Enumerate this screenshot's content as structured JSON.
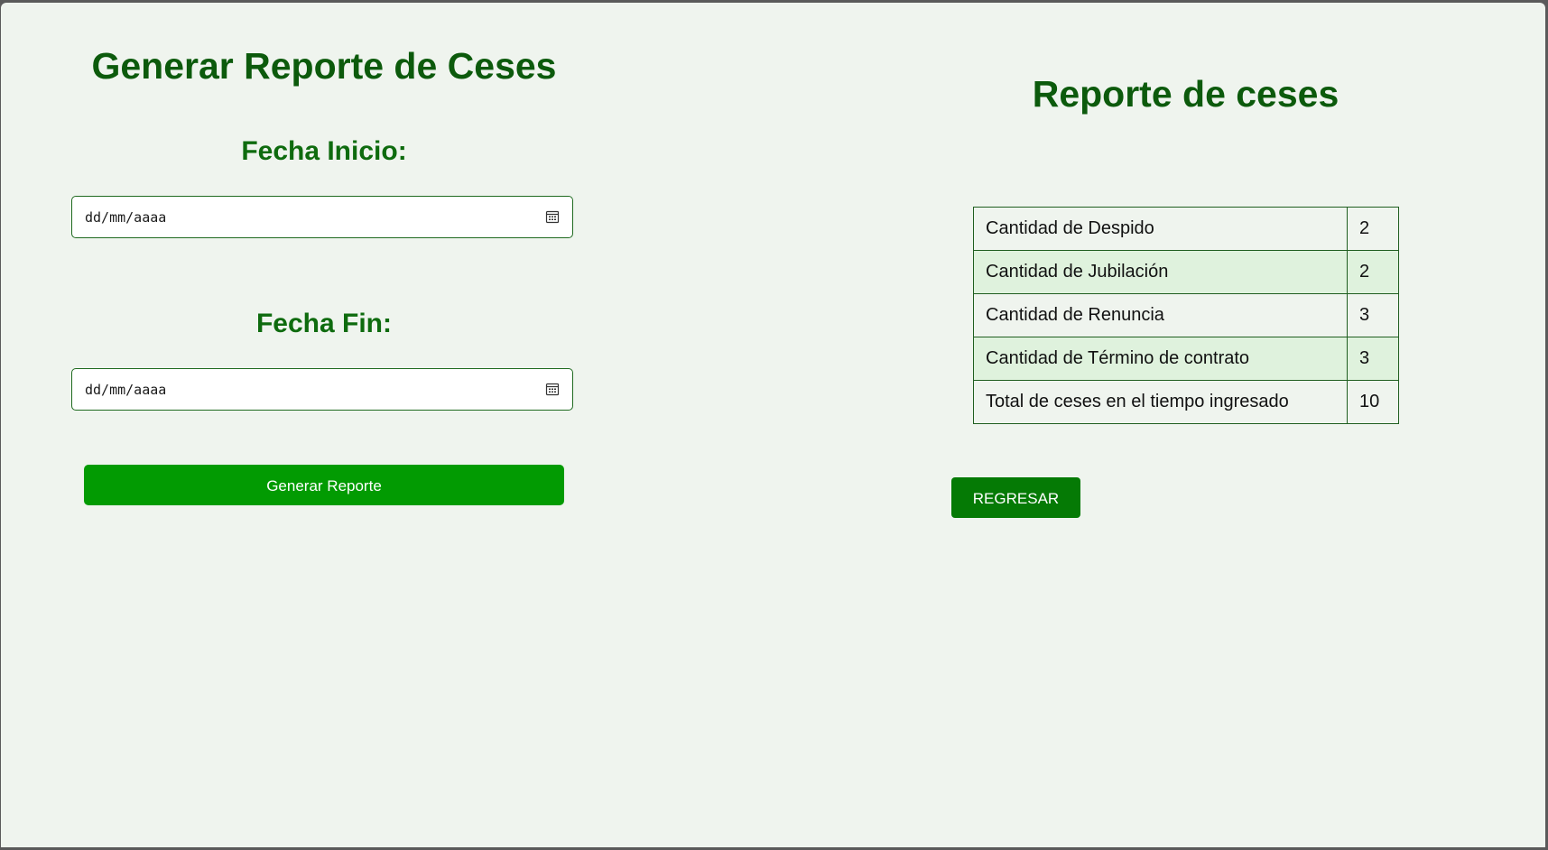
{
  "form": {
    "title": "Generar Reporte de Ceses",
    "start_label": "Fecha Inicio:",
    "start_placeholder": "dd/mm/aaaa",
    "end_label": "Fecha Fin:",
    "end_placeholder": "dd/mm/aaaa",
    "submit_label": "Generar Reporte",
    "calendar_icon": "calendar-icon"
  },
  "report": {
    "title": "Reporte de ceses",
    "rows": [
      {
        "label": "Cantidad de Despido",
        "value": "2"
      },
      {
        "label": "Cantidad de Jubilación",
        "value": "2"
      },
      {
        "label": "Cantidad de Renuncia",
        "value": "3"
      },
      {
        "label": "Cantidad de Término de contrato",
        "value": "3"
      },
      {
        "label": "Total de ceses en el tiempo ingresado",
        "value": "10"
      }
    ],
    "back_label": "REGRESAR"
  },
  "colors": {
    "page_background": "#eff4ee",
    "title_green": "#0c5a0c",
    "primary_button": "#029b02",
    "back_button": "#057a05",
    "row_shade": "#dff2dd"
  }
}
